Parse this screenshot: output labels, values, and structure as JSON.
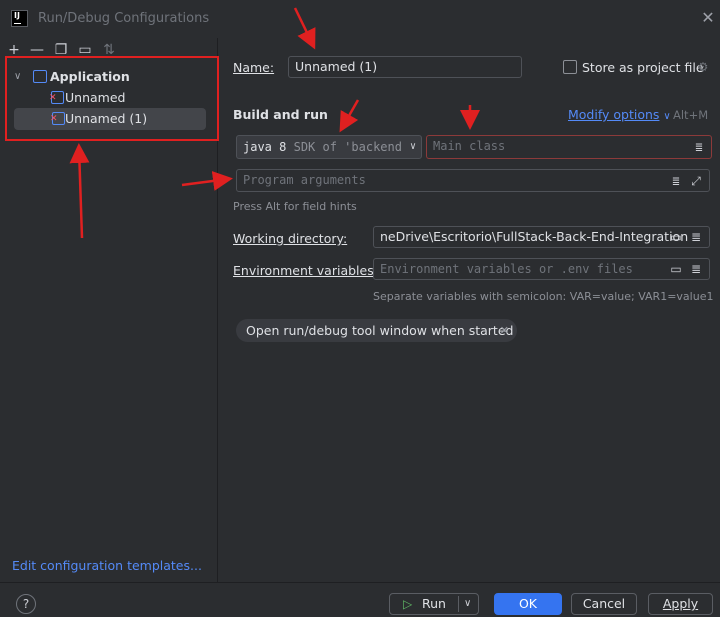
{
  "window": {
    "title": "Run/Debug Configurations",
    "logo_text": "IJ"
  },
  "sidebar": {
    "toolbar": [
      "add-icon",
      "remove-icon",
      "copy-icon",
      "folder-icon",
      "sort-icon"
    ],
    "tree": {
      "group_label": "Application",
      "items": [
        {
          "label": "Unnamed"
        },
        {
          "label": "Unnamed (1)",
          "selected": true
        }
      ]
    },
    "edit_templates_label": "Edit configuration templates..."
  },
  "form": {
    "name_label": "Name:",
    "name_value": "Unnamed (1)",
    "store_label": "Store as project file",
    "store_checked": false,
    "section_title": "Build and run",
    "modify_options_label": "Modify options",
    "modify_options_shortcut": "Alt+M",
    "jdk": {
      "version": "java 8",
      "detail": "SDK of 'backend"
    },
    "main_class_placeholder": "Main class",
    "program_args_placeholder": "Program arguments",
    "field_hint": "Press Alt for field hints",
    "working_dir_label": "Working directory:",
    "working_dir_value": "neDrive\\Escritorio\\FullStack-Back-End-Integration",
    "env_label": "Environment variables:",
    "env_placeholder": "Environment variables or .env files",
    "env_hint": "Separate variables with semicolon: VAR=value; VAR1=value1",
    "tag_chip_label": "Open run/debug tool window when started"
  },
  "footer": {
    "help_label": "?",
    "run_label": "Run",
    "ok_label": "OK",
    "cancel_label": "Cancel",
    "apply_label": "Apply"
  },
  "colors": {
    "background": "#2b2d30",
    "accent": "#3574f0",
    "link": "#548af7",
    "annotation": "#e02020",
    "error_border": "#8c3a3a"
  }
}
